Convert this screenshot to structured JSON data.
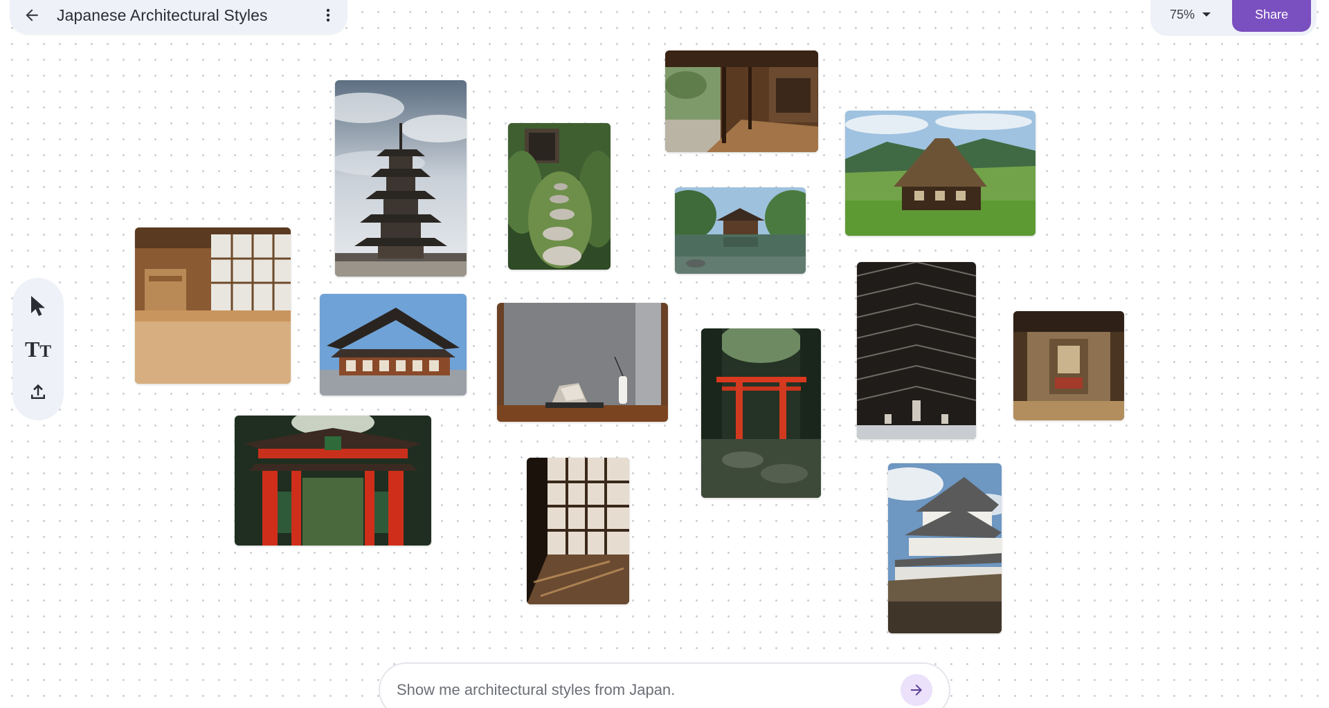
{
  "header": {
    "title": "Japanese Architectural Styles",
    "back_icon": "arrow-left-icon",
    "more_icon": "more-vertical-icon"
  },
  "top_right": {
    "zoom_label": "75%",
    "share_label": "Share",
    "accent_color": "#7a4fbf"
  },
  "toolbar": {
    "tools": [
      {
        "icon": "pointer-icon"
      },
      {
        "icon": "text-icon",
        "glyph_big": "T",
        "glyph_small": "T"
      },
      {
        "icon": "upload-icon"
      }
    ]
  },
  "canvas": {
    "images": [
      {
        "subject": "five-story pagoda under cloudy sky"
      },
      {
        "subject": "moss garden stone path"
      },
      {
        "subject": "wooden engawa veranda with garden"
      },
      {
        "subject": "thatched gassho farmhouse in rice fields"
      },
      {
        "subject": "tatami room with shoji screens"
      },
      {
        "subject": "temple hall with tiled roof"
      },
      {
        "subject": "pavilion reflected in pond"
      },
      {
        "subject": "tokonoma alcove with stone and vase"
      },
      {
        "subject": "eaves bracket detail from below"
      },
      {
        "subject": "tea room interior"
      },
      {
        "subject": "vermilion torii gate in forest"
      },
      {
        "subject": "red shrine gate"
      },
      {
        "subject": "shoji screen corridor with shadows"
      },
      {
        "subject": "white castle on stone walls"
      }
    ]
  },
  "prompt": {
    "placeholder": "Show me architectural styles from Japan.",
    "send_icon": "arrow-right-icon"
  }
}
